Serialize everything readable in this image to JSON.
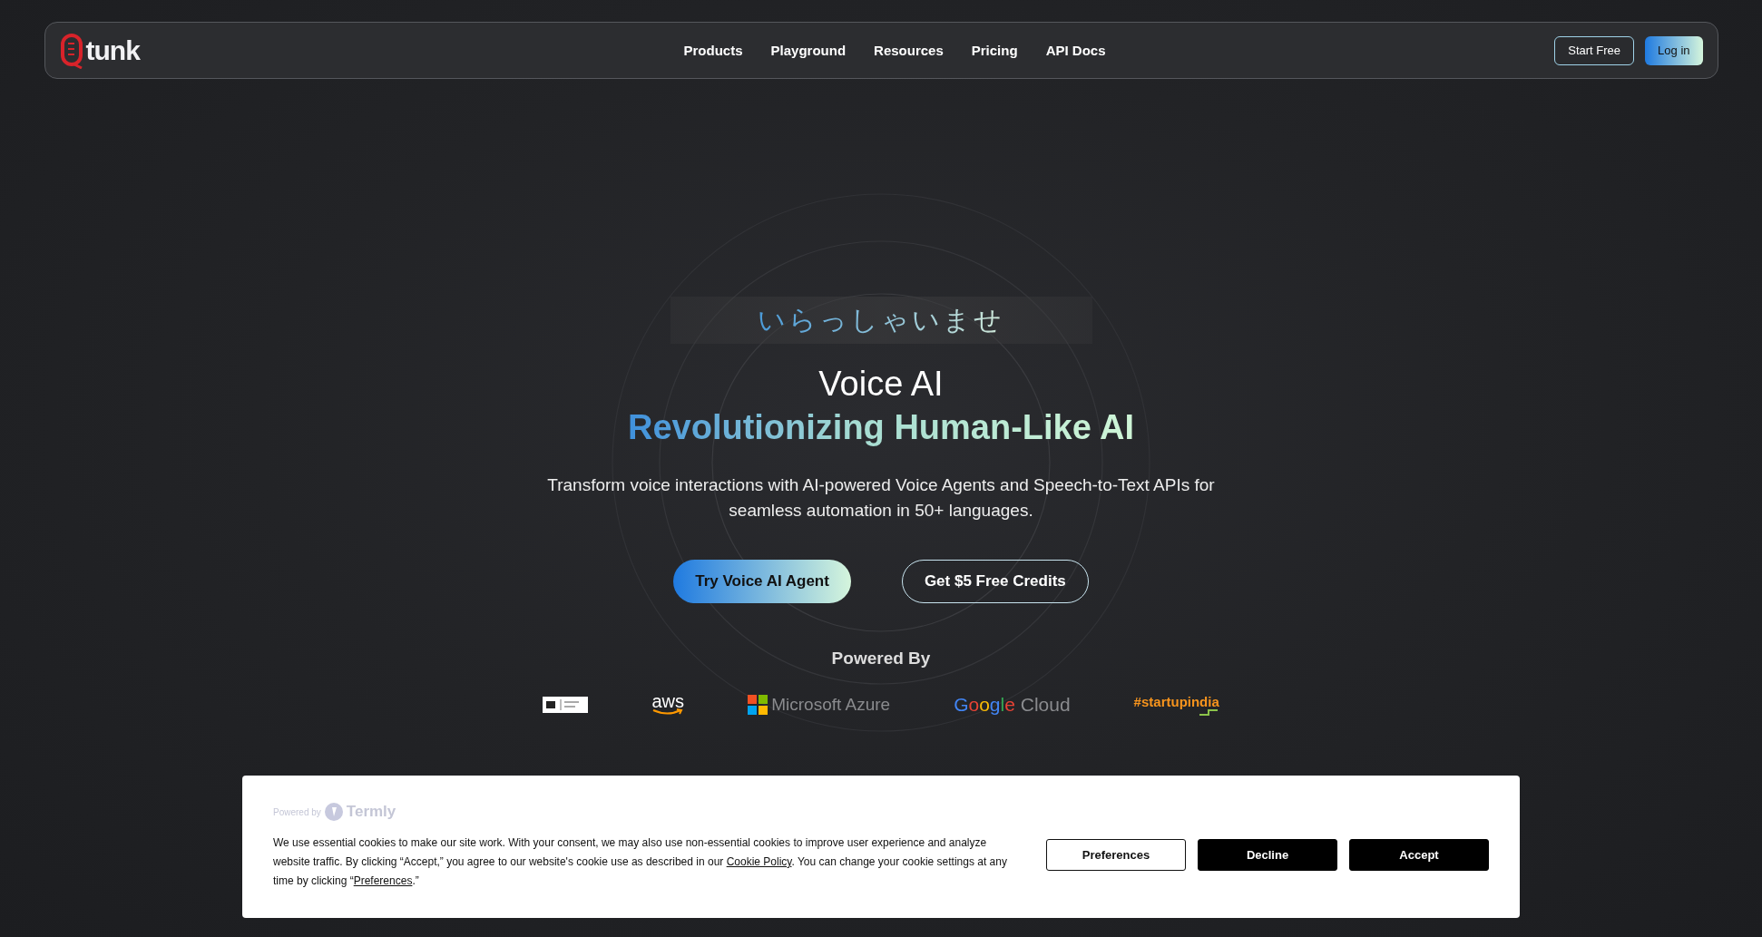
{
  "header": {
    "logo": "tunk",
    "nav": [
      "Products",
      "Playground",
      "Resources",
      "Pricing",
      "API Docs"
    ],
    "actions": [
      {
        "label": "Start Free",
        "kind": "outline"
      },
      {
        "label": "Log in",
        "kind": "filled"
      }
    ]
  },
  "hero": {
    "greeting": "いらっしゃいませ",
    "title": "Voice AI",
    "subtitle": "Revolutionizing Human-Like AI",
    "description": "Transform voice interactions with AI-powered Voice Agents and Speech-to-Text APIs for seamless automation in 50+ languages.",
    "buttons": [
      {
        "label": "Try Voice AI Agent",
        "kind": "filled"
      },
      {
        "label": "Get $5 Free Credits",
        "kind": "outline"
      }
    ]
  },
  "partners": {
    "heading": "Powered By",
    "logos": [
      {
        "kind": "badge"
      },
      {
        "kind": "aws",
        "text": "aws"
      },
      {
        "kind": "microsoft",
        "text": "Microsoft Azure"
      },
      {
        "kind": "google",
        "text": "Google",
        "suffix": "Cloud"
      },
      {
        "kind": "startup",
        "text": "#startupindia"
      }
    ]
  },
  "cookie_banner": {
    "powered_by": "Powered by",
    "brand": "Termly",
    "text_1": "We use essential cookies to make our site work. With your consent, we may also use non-essential cookies to improve user experience and analyze website traffic. By clicking “Accept,” you agree to our website's cookie use as described in our ",
    "link_1": "Cookie Policy",
    "text_2": ". You can change your cookie settings at any time by clicking “",
    "link_2": "Preferences",
    "text_3": ".”",
    "buttons": [
      {
        "label": "Preferences",
        "kind": "outline"
      },
      {
        "label": "Decline",
        "kind": "filled"
      },
      {
        "label": "Accept",
        "kind": "filled"
      }
    ]
  }
}
